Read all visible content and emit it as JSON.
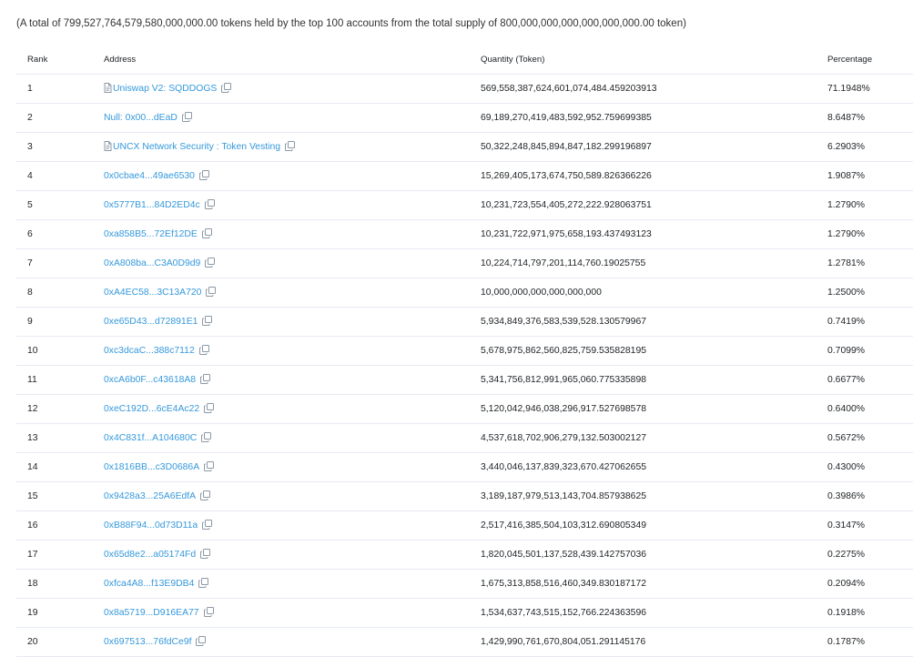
{
  "summary": "(A total of 799,527,764,579,580,000,000.00 tokens held by the top 100 accounts from the total supply of 800,000,000,000,000,000,000.00 token)",
  "headers": {
    "rank": "Rank",
    "address": "Address",
    "quantity": "Quantity (Token)",
    "percentage": "Percentage"
  },
  "rows": [
    {
      "rank": "1",
      "address": "Uniswap V2: SQDDOGS",
      "quantity": "569,558,387,624,601,074,484.459203913",
      "percentage": "71.1948%",
      "icon": "contract-icon"
    },
    {
      "rank": "2",
      "address": "Null: 0x00...dEaD",
      "quantity": "69,189,270,419,483,592,952.759699385",
      "percentage": "8.6487%",
      "icon": ""
    },
    {
      "rank": "3",
      "address": "UNCX Network Security : Token Vesting",
      "quantity": "50,322,248,845,894,847,182.299196897",
      "percentage": "6.2903%",
      "icon": "contract-icon"
    },
    {
      "rank": "4",
      "address": "0x0cbae4...49ae6530",
      "quantity": "15,269,405,173,674,750,589.826366226",
      "percentage": "1.9087%",
      "icon": ""
    },
    {
      "rank": "5",
      "address": "0x5777B1...84D2ED4c",
      "quantity": "10,231,723,554,405,272,222.928063751",
      "percentage": "1.2790%",
      "icon": ""
    },
    {
      "rank": "6",
      "address": "0xa858B5...72Ef12DE",
      "quantity": "10,231,722,971,975,658,193.437493123",
      "percentage": "1.2790%",
      "icon": ""
    },
    {
      "rank": "7",
      "address": "0xA808ba...C3A0D9d9",
      "quantity": "10,224,714,797,201,114,760.19025755",
      "percentage": "1.2781%",
      "icon": ""
    },
    {
      "rank": "8",
      "address": "0xA4EC58...3C13A720",
      "quantity": "10,000,000,000,000,000,000",
      "percentage": "1.2500%",
      "icon": ""
    },
    {
      "rank": "9",
      "address": "0xe65D43...d72891E1",
      "quantity": "5,934,849,376,583,539,528.130579967",
      "percentage": "0.7419%",
      "icon": ""
    },
    {
      "rank": "10",
      "address": "0xc3dcaC...388c7112",
      "quantity": "5,678,975,862,560,825,759.535828195",
      "percentage": "0.7099%",
      "icon": ""
    },
    {
      "rank": "11",
      "address": "0xcA6b0F...c43618A8",
      "quantity": "5,341,756,812,991,965,060.775335898",
      "percentage": "0.6677%",
      "icon": ""
    },
    {
      "rank": "12",
      "address": "0xeC192D...6cE4Ac22",
      "quantity": "5,120,042,946,038,296,917.527698578",
      "percentage": "0.6400%",
      "icon": ""
    },
    {
      "rank": "13",
      "address": "0x4C831f...A104680C",
      "quantity": "4,537,618,702,906,279,132.503002127",
      "percentage": "0.5672%",
      "icon": ""
    },
    {
      "rank": "14",
      "address": "0x1816BB...c3D0686A",
      "quantity": "3,440,046,137,839,323,670.427062655",
      "percentage": "0.4300%",
      "icon": ""
    },
    {
      "rank": "15",
      "address": "0x9428a3...25A6EdfA",
      "quantity": "3,189,187,979,513,143,704.857938625",
      "percentage": "0.3986%",
      "icon": ""
    },
    {
      "rank": "16",
      "address": "0xB88F94...0d73D11a",
      "quantity": "2,517,416,385,504,103,312.690805349",
      "percentage": "0.3147%",
      "icon": ""
    },
    {
      "rank": "17",
      "address": "0x65d8e2...a05174Fd",
      "quantity": "1,820,045,501,137,528,439.142757036",
      "percentage": "0.2275%",
      "icon": ""
    },
    {
      "rank": "18",
      "address": "0xfca4A8...f13E9DB4",
      "quantity": "1,675,313,858,516,460,349.830187172",
      "percentage": "0.2094%",
      "icon": ""
    },
    {
      "rank": "19",
      "address": "0x8a5719...D916EA77",
      "quantity": "1,534,637,743,515,152,766.224363596",
      "percentage": "0.1918%",
      "icon": ""
    },
    {
      "rank": "20",
      "address": "0x697513...76fdCe9f",
      "quantity": "1,429,990,761,670,804,051.291145176",
      "percentage": "0.1787%",
      "icon": ""
    }
  ],
  "colors": {
    "link": "#3498db",
    "border": "#e7eaf3",
    "text": "#212529"
  }
}
